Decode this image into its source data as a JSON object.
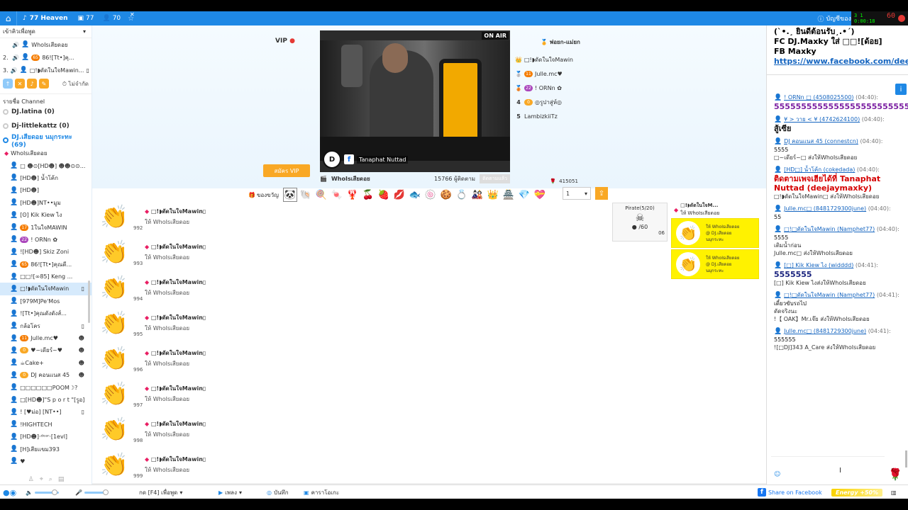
{
  "topbar": {
    "room_name": "77 Heaven",
    "count_a": "77",
    "count_b": "70",
    "account_label": "บัญชีของ",
    "rec_lines": [
      "3 1",
      "0:00:18"
    ],
    "rec_number": "60"
  },
  "left": {
    "speak_queue_title": "เข้าคิวเพื่อพูด",
    "speakers": [
      {
        "num": "",
        "badge": "",
        "name": "WhoIsเสียดอย",
        "end": ""
      },
      {
        "num": "2.",
        "badge": "65",
        "name": "86![Tt•]คุ...",
        "end": ""
      },
      {
        "num": "3.",
        "badge": "",
        "name": "□!◗ดัดในใจMawin...",
        "end": "▯"
      }
    ],
    "unlimited": "ไม่จำกัด",
    "channel_title": "รายชื่อ Channel",
    "channels": [
      {
        "name": "DJ.latina (0)",
        "active": false
      },
      {
        "name": "Dj-littlekattz (0)",
        "active": false
      },
      {
        "name": "DJ.เสียดอย นมุกระทะ (69)",
        "active": true
      }
    ],
    "channel_owner": "WhoIsเสียดอย",
    "users": [
      {
        "badge": "",
        "name": "□ ☻⊙[HD☻] ☻☻⊙⊙...",
        "end": "",
        "sel": false
      },
      {
        "badge": "",
        "name": "[HD☻] น้ำโค้ก",
        "end": "",
        "sel": false
      },
      {
        "badge": "",
        "name": "[HD☻]",
        "end": "",
        "sel": false
      },
      {
        "badge": "",
        "name": "[HD☻]NT••มูม",
        "end": "",
        "sel": false
      },
      {
        "badge": "",
        "name": "[ʘ] Kik Kiew ไง",
        "end": "",
        "sel": false
      },
      {
        "badge": "17",
        "name": "1ในใจMAWIN",
        "end": "",
        "sel": false
      },
      {
        "badge": "22",
        "name": "! ORNn ✿",
        "end": "",
        "sel": false
      },
      {
        "badge": "",
        "name": "![HD☻] Skiz Zoni",
        "end": "",
        "sel": false
      },
      {
        "badge": "65",
        "name": "86![Tt•]คุณดี...",
        "end": "",
        "sel": false
      },
      {
        "badge": "",
        "name": "□□![∞85] Keng ...",
        "end": "",
        "sel": false
      },
      {
        "badge": "",
        "name": "□!◗ดัดในใจMawin",
        "end": "▯",
        "sel": true
      },
      {
        "badge": "",
        "name": "[979M]Pe'Mos",
        "end": "",
        "sel": false
      },
      {
        "badge": "",
        "name": "![Tt•]คุณดังดังส์...",
        "end": "",
        "sel": false
      },
      {
        "badge": "",
        "name": "กล้อโคร",
        "end": "▯",
        "sel": false
      },
      {
        "badge": "11",
        "name": "Julle.mc♥",
        "end": "☻",
        "sel": false
      },
      {
        "badge": "0",
        "name": "♥~เดียร์~♥",
        "end": "☻",
        "sel": false
      },
      {
        "badge": "",
        "name": "☕Cake+",
        "end": "☻",
        "sel": false
      },
      {
        "badge": "0",
        "name": "DJ คอนแนส 45",
        "end": "☻",
        "sel": false
      },
      {
        "badge": "",
        "name": "□□□□□□POOM☽?",
        "end": "",
        "sel": false
      },
      {
        "badge": "",
        "name": "□[HD☻]\"S p o r t \"[รูอ]",
        "end": "",
        "sel": false
      },
      {
        "badge": "",
        "name": "! [♥ม่อ] [NT••]",
        "end": "▯",
        "sel": false
      },
      {
        "badge": "",
        "name": "!HIGHTECH",
        "end": "",
        "sel": false
      },
      {
        "badge": "",
        "name": "[HD☻]·ᵈᵉᵃʳ·[1evl]",
        "end": "",
        "sel": false
      },
      {
        "badge": "",
        "name": "[H]เสียแขม393",
        "end": "",
        "sel": false
      },
      {
        "badge": "",
        "name": "♥",
        "end": "",
        "sel": false
      }
    ]
  },
  "stage": {
    "vip_label": "VIP",
    "vip_button": "สมัคร VIP",
    "onair": "ON AIR",
    "video_tag": "Tanaphat Nuttad",
    "dj_name": "WhoIsเสียดอย",
    "viewers": "15766 ผู้ติดตาม",
    "follow_tab": "ติดตามแล้ว",
    "podium_title": "พ่อยก-แม่ยก",
    "podium": [
      {
        "rank": "",
        "badge": "",
        "name": "□!◗ดัดในใจMawin"
      },
      {
        "rank": "",
        "badge": "11",
        "name": "Julle.mc♥"
      },
      {
        "rank": "",
        "badge": "22",
        "name": "! ORNn ✿"
      },
      {
        "rank": "4",
        "badge": "0",
        "name": "◎รูปาสู่ห์◎"
      },
      {
        "rank": "5",
        "badge": "",
        "name": "LambizkiiTz"
      }
    ],
    "score": "415051",
    "gift_label": "ของขวัญ",
    "gift_icons": [
      "🐼",
      "🐚",
      "🍭",
      "🍬",
      "🦞",
      "🍒",
      "🍓",
      "💋",
      "🐟",
      "🍥",
      "🍪",
      "💍",
      "🎎",
      "👑",
      "🏯",
      "💎",
      "💝"
    ],
    "qty": "1",
    "feed": [
      {
        "count": "992",
        "name": "□!◗ดัดในใจMawin▯",
        "to": "ให้ WhoIsเสียดอย"
      },
      {
        "count": "993",
        "name": "□!◗ดัดในใจMawin▯",
        "to": "ให้ WhoIsเสียดอย"
      },
      {
        "count": "994",
        "name": "□!◗ดัดในใจMawin▯",
        "to": "ให้ WhoIsเสียดอย"
      },
      {
        "count": "995",
        "name": "□!◗ดัดในใจMawin▯",
        "to": "ให้ WhoIsเสียดอย"
      },
      {
        "count": "996",
        "name": "□!◗ดัดในใจMawin▯",
        "to": "ให้ WhoIsเสียดอย"
      },
      {
        "count": "997",
        "name": "□!◗ดัดในใจMawin▯",
        "to": "ให้ WhoIsเสียดอย"
      },
      {
        "count": "998",
        "name": "□!◗ดัดในใจMawin▯",
        "to": "ให้ WhoIsเสียดอย"
      },
      {
        "count": "999",
        "name": "□!◗ดัดในใจMawin▯",
        "to": "ให้ WhoIsเสียดอย"
      }
    ],
    "pirate_title": "Pirate(5/20)",
    "pirate_count": "/60",
    "pirate_foot": "06",
    "gift_head_name": "□!◗ดัดในใจM...",
    "gift_head_to": "ให้ WhoIsเสียดอย",
    "gift_cards": [
      {
        "line1": "ให้ WhoIsเสียดอย",
        "line2": "@ DJ.เสียดอย",
        "line3": "นมุกระทะ"
      },
      {
        "line1": "ให้ WhoIsเสียดอย",
        "line2": "@ DJ.เสียดอย",
        "line3": "นมุกระทะ"
      }
    ]
  },
  "chat": {
    "pin_lines": [
      "(`•.¸ ยินดีต้อนรับ¸.•´)",
      "FC DJ.Maxky ใส่ □□![ด้อย]",
      "FB Maxky"
    ],
    "pin_link": "https://www.facebook.com/deejay.maxky",
    "messages": [
      {
        "who": "! ORNn □ (4508025500)",
        "time": "(04:40):",
        "lines": [
          "55555555555555555555555555"
        ],
        "style": "big purple"
      },
      {
        "who": "¥ > วาย < ¥ (4742624100)",
        "time": "(04:40):",
        "lines": [
          "สู้เซีย"
        ],
        "style": "big dark"
      },
      {
        "who": "DJ คอนแนส 45 (connestcn)",
        "time": "(04:40):",
        "lines": [
          "5555",
          "□~เดียร์~□ ส่งให้WhoIsเสียดอย"
        ],
        "style": "dark"
      },
      {
        "who": "[HD□] น้ำโค้ก (cokedada)",
        "time": "(04:40):",
        "lines": [
          "ติดตามเพจเฮียได้ที่ Tanaphat Nuttad (deejaymaxky)",
          "□!◗ดัดในใจMawin□ ส่งให้WhoIsเสียดอย"
        ],
        "style": "big red"
      },
      {
        "who": "Julle.mc□ (8481729300june)",
        "time": "(04:40):",
        "lines": [
          "55"
        ],
        "style": "dark"
      },
      {
        "who": "□!□ดัดในใจMawin (Namphet77)",
        "time": "(04:40):",
        "lines": [
          "5555",
          "เติมน้ำก่อน",
          "Julle.mc□ ส่งให้WhoIsเสียดอย"
        ],
        "style": "dark"
      },
      {
        "who": "[□] Kik Kiew ไง (widddd)",
        "time": "(04:41):",
        "lines": [
          "5555555",
          "[□] Kik Kiew ไงส่งให้WhoIsเสียดอย"
        ],
        "style": "big navy"
      },
      {
        "who": "□!□ดัดในใจMawin (Namphet77)",
        "time": "(04:41):",
        "lines": [
          "เดี๋ยวขับรถไป",
          "ดัดจริงนะ",
          "!【 OAK】Mr.เจ๊ย ส่งให้WhoIsเสียดอย"
        ],
        "style": "dark"
      },
      {
        "who": "Julle.mc□ (8481729300june)",
        "time": "(04:41):",
        "lines": [
          "555555",
          "![□DJ]343 A_Care ส่งให้WhoIsเสียดอย"
        ],
        "style": "dark"
      }
    ]
  },
  "bottom": {
    "push_to_talk": "กด [F4] เพื่อพูด",
    "songs": "เพลง",
    "record": "บันทึก",
    "karaoke": "คาราโอเกะ",
    "share": "Share on Facebook",
    "energy": "Energy +50%"
  },
  "colors": {
    "primary": "#1e88e5",
    "accent": "#f9a825",
    "gift_card": "#fff200",
    "vip": "#e53935"
  }
}
